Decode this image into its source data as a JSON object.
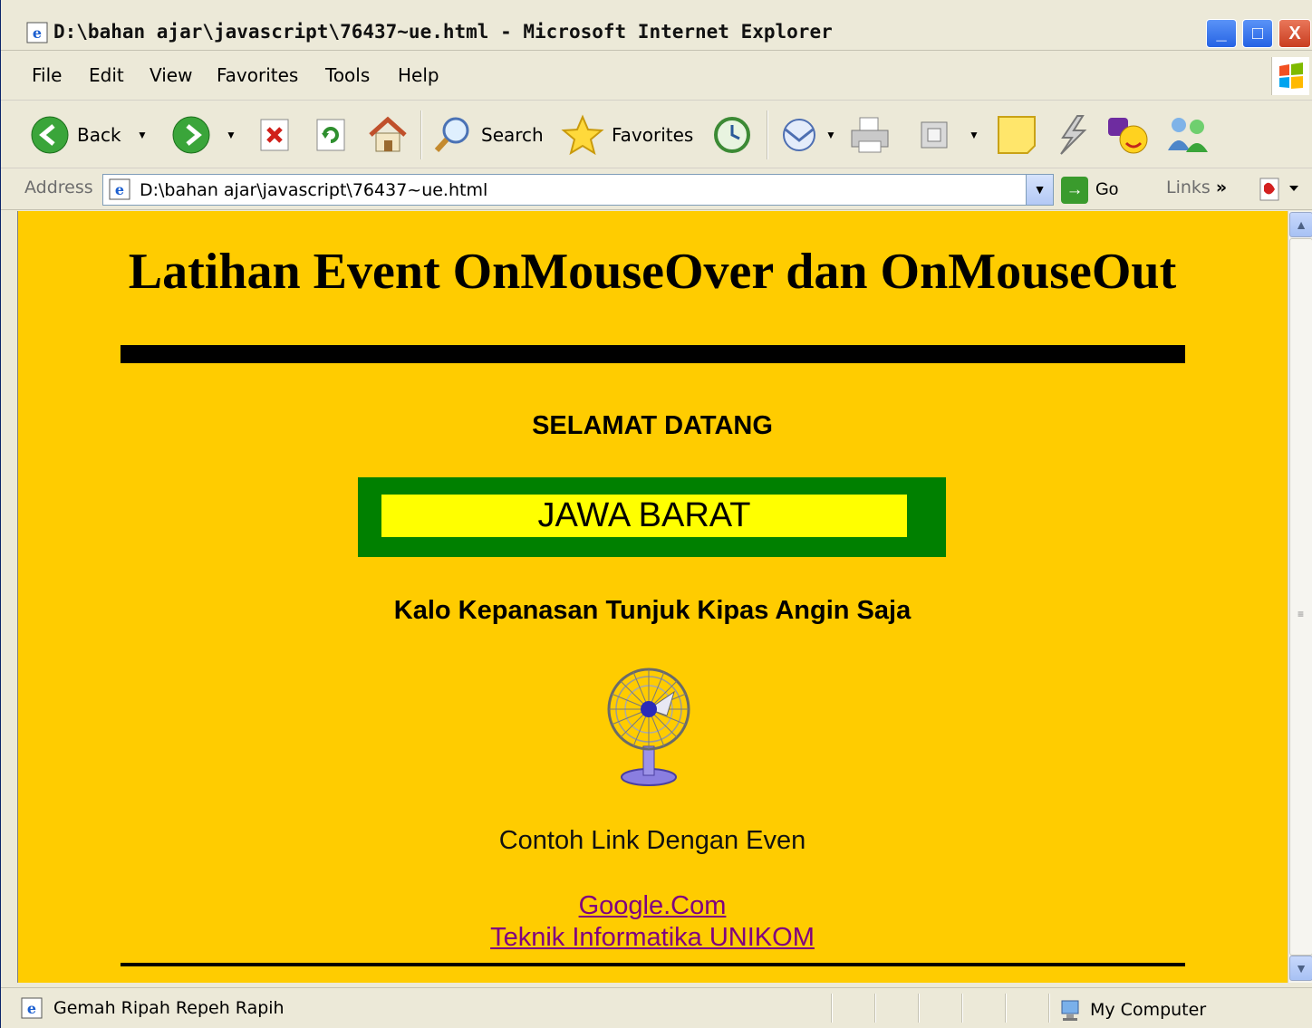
{
  "window": {
    "title": "D:\\bahan ajar\\javascript\\76437~ue.html - Microsoft Internet Explorer",
    "minimize": "_",
    "maximize": "□",
    "close": "X"
  },
  "menu": [
    {
      "label": "File"
    },
    {
      "label": "Edit"
    },
    {
      "label": "View"
    },
    {
      "label": "Favorites"
    },
    {
      "label": "Tools"
    },
    {
      "label": "Help"
    }
  ],
  "toolbar": {
    "back_label": "Back",
    "search_label": "Search",
    "favorites_label": "Favorites"
  },
  "address": {
    "label": "Address",
    "url": "D:\\bahan ajar\\javascript\\76437~ue.html",
    "go_label": "Go",
    "links_label": "Links"
  },
  "page": {
    "title": "Latihan Event OnMouseOver dan OnMouseOut",
    "welcome": "SELAMAT DATANG",
    "marquee_text": "JAWA BARAT",
    "hint": "Kalo Kepanasan Tunjuk Kipas Angin Saja",
    "link_caption": "Contoh Link Dengan Even",
    "links": [
      {
        "label": "Google.Com"
      },
      {
        "label": "Teknik Informatika UNIKOM"
      }
    ],
    "colors": {
      "background": "#ffcc00",
      "marquee_border": "#008000",
      "marquee_fill": "#ffff00",
      "visited_link": "#800080"
    }
  },
  "status": {
    "text": "Gemah Ripah Repeh Rapih",
    "zone": "My Computer"
  },
  "icons": [
    "ie-page-icon",
    "back-arrow-icon",
    "forward-arrow-icon",
    "stop-icon",
    "refresh-icon",
    "home-icon",
    "search-icon",
    "favorites-star-icon",
    "history-icon",
    "mail-icon",
    "print-icon",
    "edit-icon",
    "notes-icon",
    "messenger-icon",
    "yahoo-icon",
    "contacts-icon",
    "go-arrow-icon",
    "pdf-icon",
    "fan-image",
    "computer-icon"
  ]
}
